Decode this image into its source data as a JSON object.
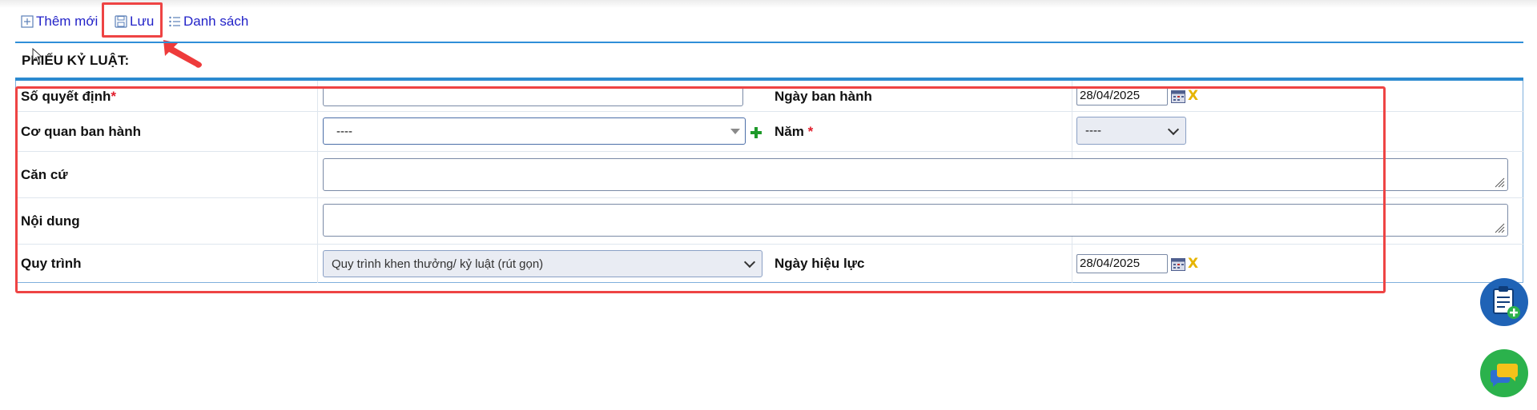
{
  "toolbar": {
    "add_label": "Thêm mới",
    "save_label": "Lưu",
    "list_label": "Danh sách"
  },
  "form": {
    "title": "PHIẾU KỶ LUẬT:",
    "so_quyet_dinh": {
      "label": "Số quyết định",
      "required_mark": "*",
      "value": ""
    },
    "ngay_ban_hanh": {
      "label": "Ngày ban hành",
      "value": "28/04/2025"
    },
    "co_quan_ban_hanh": {
      "label": "Cơ quan ban hành",
      "selected": "----"
    },
    "nam": {
      "label": "Năm",
      "required_mark": "*",
      "selected": "----"
    },
    "can_cu": {
      "label": "Căn cứ",
      "value": ""
    },
    "noi_dung": {
      "label": "Nội dung",
      "value": ""
    },
    "quy_trinh": {
      "label": "Quy trình",
      "selected": "Quy trình khen thưởng/ kỷ luật (rút gọn)"
    },
    "ngay_hieu_luc": {
      "label": "Ngày hiệu lực",
      "value": "28/04/2025"
    },
    "clear_glyph": "X"
  },
  "colors": {
    "link": "#2323c8",
    "accent_blue": "#2b8ad0",
    "required": "#e01d2b",
    "highlight": "#e44444",
    "fab_blue": "#1f63b6",
    "fab_green": "#2bb24c"
  },
  "icons": [
    "add-icon",
    "save-icon",
    "list-icon",
    "calendar-icon",
    "clear-icon",
    "plus-icon",
    "clipboard-add-icon",
    "chat-icon"
  ]
}
